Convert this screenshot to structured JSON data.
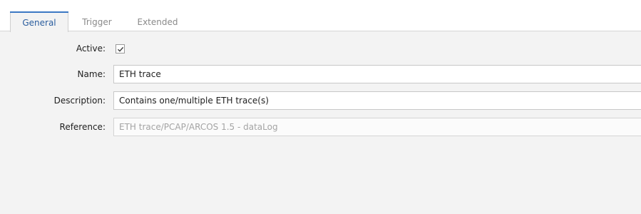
{
  "tabs": [
    {
      "label": "General",
      "active": true
    },
    {
      "label": "Trigger",
      "active": false
    },
    {
      "label": "Extended",
      "active": false
    }
  ],
  "form": {
    "active": {
      "label": "Active:",
      "checked": true
    },
    "name": {
      "label": "Name:",
      "value": "ETH trace"
    },
    "description": {
      "label": "Description:",
      "value": "Contains one/multiple ETH trace(s)"
    },
    "reference": {
      "label": "Reference:",
      "value": "ETH trace/PCAP/ARCOS 1.5 - dataLog",
      "disabled": true
    }
  },
  "colors": {
    "accent": "#3c78c3",
    "active_tab_text": "#2a5d9e",
    "inactive_tab_text": "#8a8a8a",
    "panel_background": "#f3f3f3",
    "disabled_text": "#a4a4a4"
  },
  "icons": {
    "checkbox_mark": "check-icon"
  }
}
